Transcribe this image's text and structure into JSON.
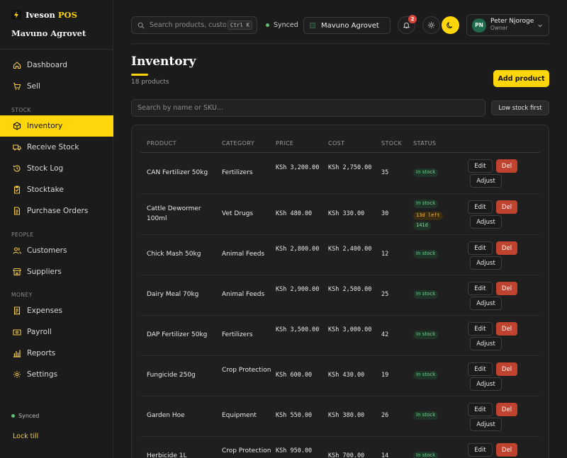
{
  "brand": {
    "name": "Iveson",
    "suffix": "POS",
    "org": "Mavuno Agrovet"
  },
  "sidebar": {
    "items": [
      {
        "label": "Dashboard",
        "icon": "home-icon"
      },
      {
        "label": "Sell",
        "icon": "cart-icon"
      },
      {
        "section": "STOCK"
      },
      {
        "label": "Inventory",
        "icon": "box-icon",
        "active": true
      },
      {
        "label": "Receive Stock",
        "icon": "truck-icon"
      },
      {
        "label": "Stock Log",
        "icon": "history-icon"
      },
      {
        "label": "Stocktake",
        "icon": "clipboard-check-icon"
      },
      {
        "label": "Purchase Orders",
        "icon": "document-icon"
      },
      {
        "section": "PEOPLE"
      },
      {
        "label": "Customers",
        "icon": "users-icon"
      },
      {
        "label": "Suppliers",
        "icon": "store-icon"
      },
      {
        "section": "MONEY"
      },
      {
        "label": "Expenses",
        "icon": "receipt-icon"
      },
      {
        "label": "Payroll",
        "icon": "wallet-icon"
      },
      {
        "label": "Reports",
        "icon": "bar-chart-icon"
      },
      {
        "label": "Settings",
        "icon": "gear-icon"
      }
    ],
    "sync_status": "Synced",
    "lock_label": "Lock till"
  },
  "topbar": {
    "search_placeholder": "Search products, customers…",
    "shortcut": "Ctrl K",
    "sync_status": "Synced",
    "store": "Mavuno Agrovet",
    "notification_count": "2",
    "user": {
      "initials": "PN",
      "name": "Peter Njoroge",
      "role": "Owner"
    }
  },
  "page": {
    "title": "Inventory",
    "subtitle": "18 products",
    "add_label": "Add product",
    "filter_placeholder": "Search by name or SKU...",
    "low_stock_label": "Low stock first"
  },
  "table": {
    "headers": [
      "PRODUCT",
      "CATEGORY",
      "PRICE",
      "COST",
      "STOCK",
      "STATUS"
    ],
    "actions": {
      "edit": "Edit",
      "del": "Del",
      "adjust": "Adjust"
    },
    "rows": [
      {
        "product": "CAN Fertilizer 50kg",
        "category": "Fertilizers",
        "price": "KSh 3,200.00",
        "cost": "KSh 2,750.00",
        "stock": "35",
        "status": "In stock"
      },
      {
        "product": "Cattle Dewormer 100ml",
        "category": "Vet Drugs",
        "price": "KSh 480.00",
        "cost": "KSh 330.00",
        "stock": "30",
        "status": "In stock",
        "expiry": "13d left",
        "days": "141d"
      },
      {
        "product": "Chick Mash 50kg",
        "category": "Animal Feeds",
        "price": "KSh 2,800.00",
        "cost": "KSh 2,400.00",
        "stock": "12",
        "status": "In stock"
      },
      {
        "product": "Dairy Meal 70kg",
        "category": "Animal Feeds",
        "price": "KSh 2,900.00",
        "cost": "KSh 2,500.00",
        "stock": "25",
        "status": "In stock"
      },
      {
        "product": "DAP Fertilizer 50kg",
        "category": "Fertilizers",
        "price": "KSh 3,500.00",
        "cost": "KSh 3,000.00",
        "stock": "42",
        "status": "In stock"
      },
      {
        "product": "Fungicide 250g",
        "category": "Crop Protection",
        "price": "KSh 600.00",
        "cost": "KSh 430.00",
        "stock": "19",
        "status": "In stock"
      },
      {
        "product": "Garden Hoe",
        "category": "Equipment",
        "price": "KSh 550.00",
        "cost": "KSh 380.00",
        "stock": "26",
        "status": "In stock"
      },
      {
        "product": "Herbicide 1L",
        "category": "Crop Protection",
        "price": "KSh 950.00",
        "cost": "KSh 700.00",
        "stock": "14",
        "status": "In stock"
      }
    ]
  },
  "colors": {
    "accent": "#ffd60a",
    "danger": "#c0432f",
    "success": "#6fcf8e",
    "background": "#1b1b1b"
  }
}
